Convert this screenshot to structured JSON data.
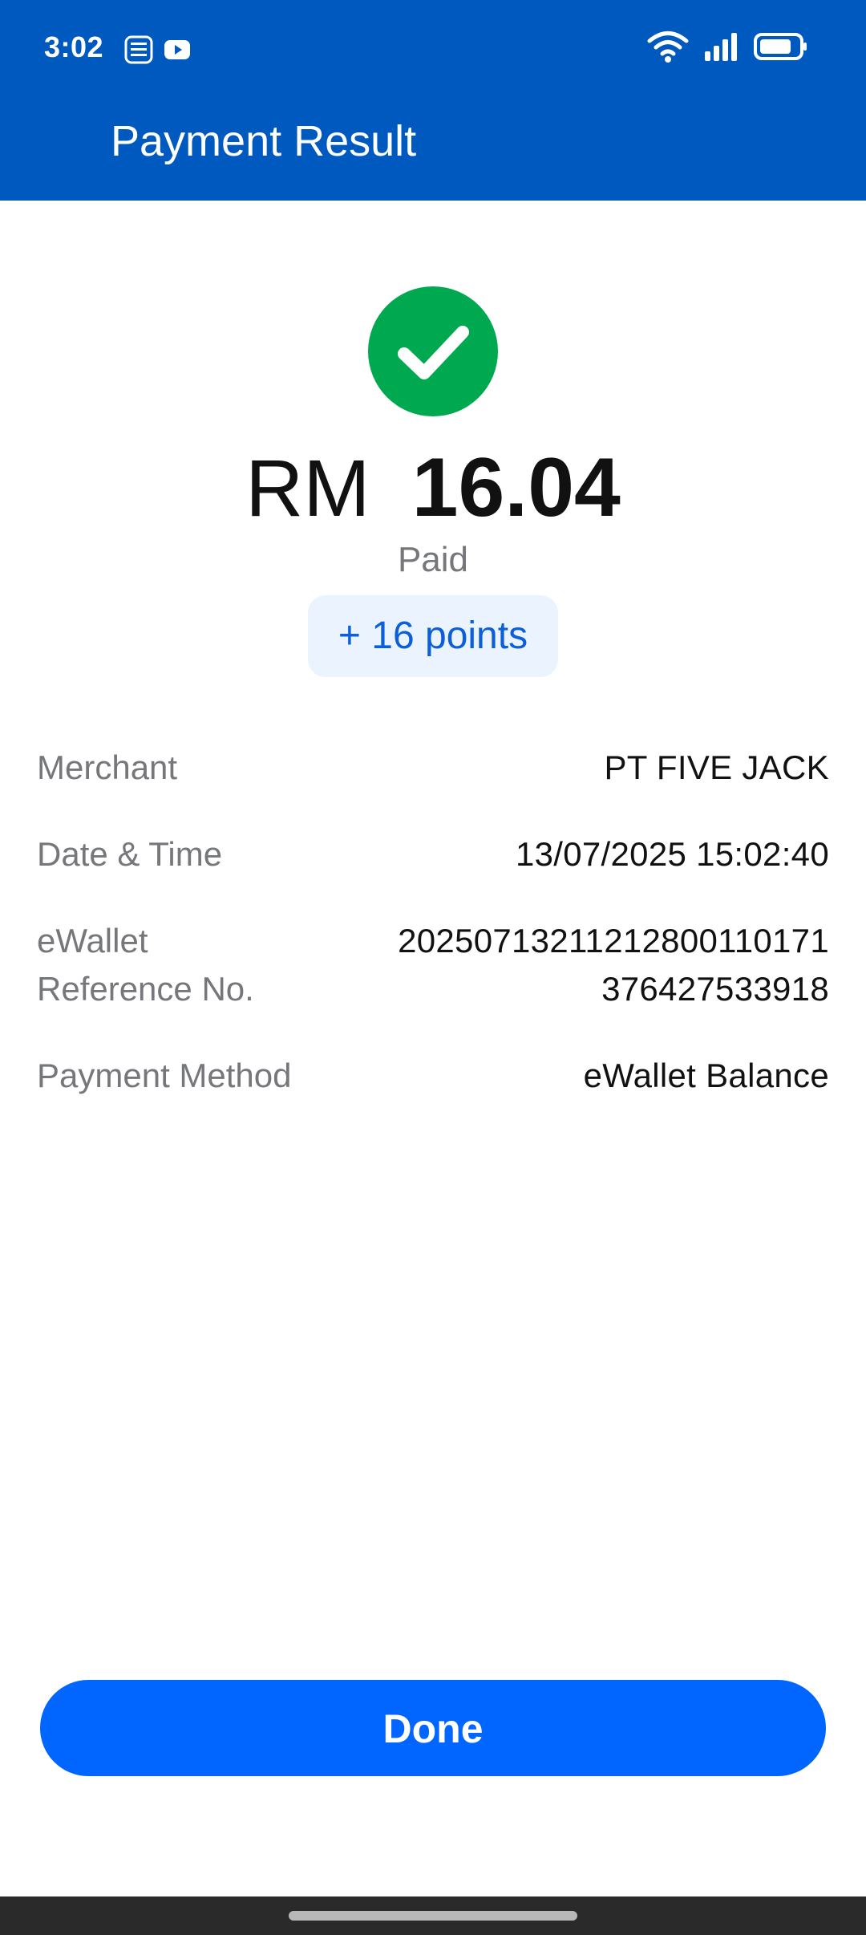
{
  "status_bar": {
    "time": "3:02",
    "left_icons": [
      "touch-n-go-ewallet-icon",
      "youtube-icon"
    ],
    "right_icons": [
      "wifi-icon",
      "signal-icon",
      "battery-icon"
    ]
  },
  "header": {
    "title": "Payment Result",
    "background_color": "#0059BE"
  },
  "result": {
    "icon": "success-check-icon",
    "success_color": "#00A94F",
    "currency": "RM",
    "amount": "16.04",
    "status": "Paid",
    "points": "+ 16 points"
  },
  "details": [
    {
      "label_lines": [
        "Merchant"
      ],
      "value_lines": [
        "PT FIVE JACK"
      ]
    },
    {
      "label_lines": [
        "Date & Time"
      ],
      "value_lines": [
        "13/07/2025 15:02:40"
      ]
    },
    {
      "label_lines": [
        "eWallet",
        "Reference No."
      ],
      "value_lines": [
        "20250713211212800110171",
        "376427533918"
      ]
    },
    {
      "label_lines": [
        "Payment Method"
      ],
      "value_lines": [
        "eWallet Balance"
      ]
    }
  ],
  "actions": {
    "done_label": "Done",
    "button_color": "#0066FF"
  }
}
